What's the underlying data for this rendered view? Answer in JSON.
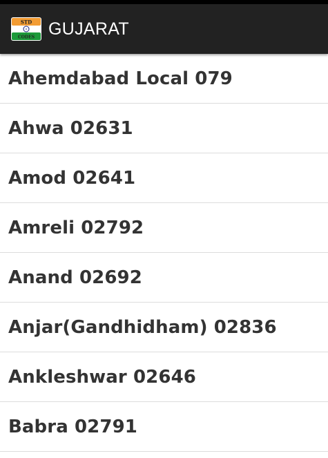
{
  "header": {
    "title": "GUJARAT",
    "icon": "std-codes-flag-icon",
    "icon_text_top": "STD",
    "icon_text_bottom": "CODES"
  },
  "list": {
    "items": [
      {
        "label": "Ahemdabad Local 079"
      },
      {
        "label": "Ahwa 02631"
      },
      {
        "label": "Amod 02641"
      },
      {
        "label": "Amreli 02792"
      },
      {
        "label": "Anand 02692"
      },
      {
        "label": "Anjar(Gandhidham) 02836"
      },
      {
        "label": "Ankleshwar 02646"
      },
      {
        "label": "Babra 02791"
      }
    ]
  },
  "colors": {
    "action_bar": "#222222",
    "divider": "#dcdcdc",
    "item_text": "#333333",
    "flag_saffron": "#f39c33",
    "flag_green": "#1c9a3a"
  }
}
